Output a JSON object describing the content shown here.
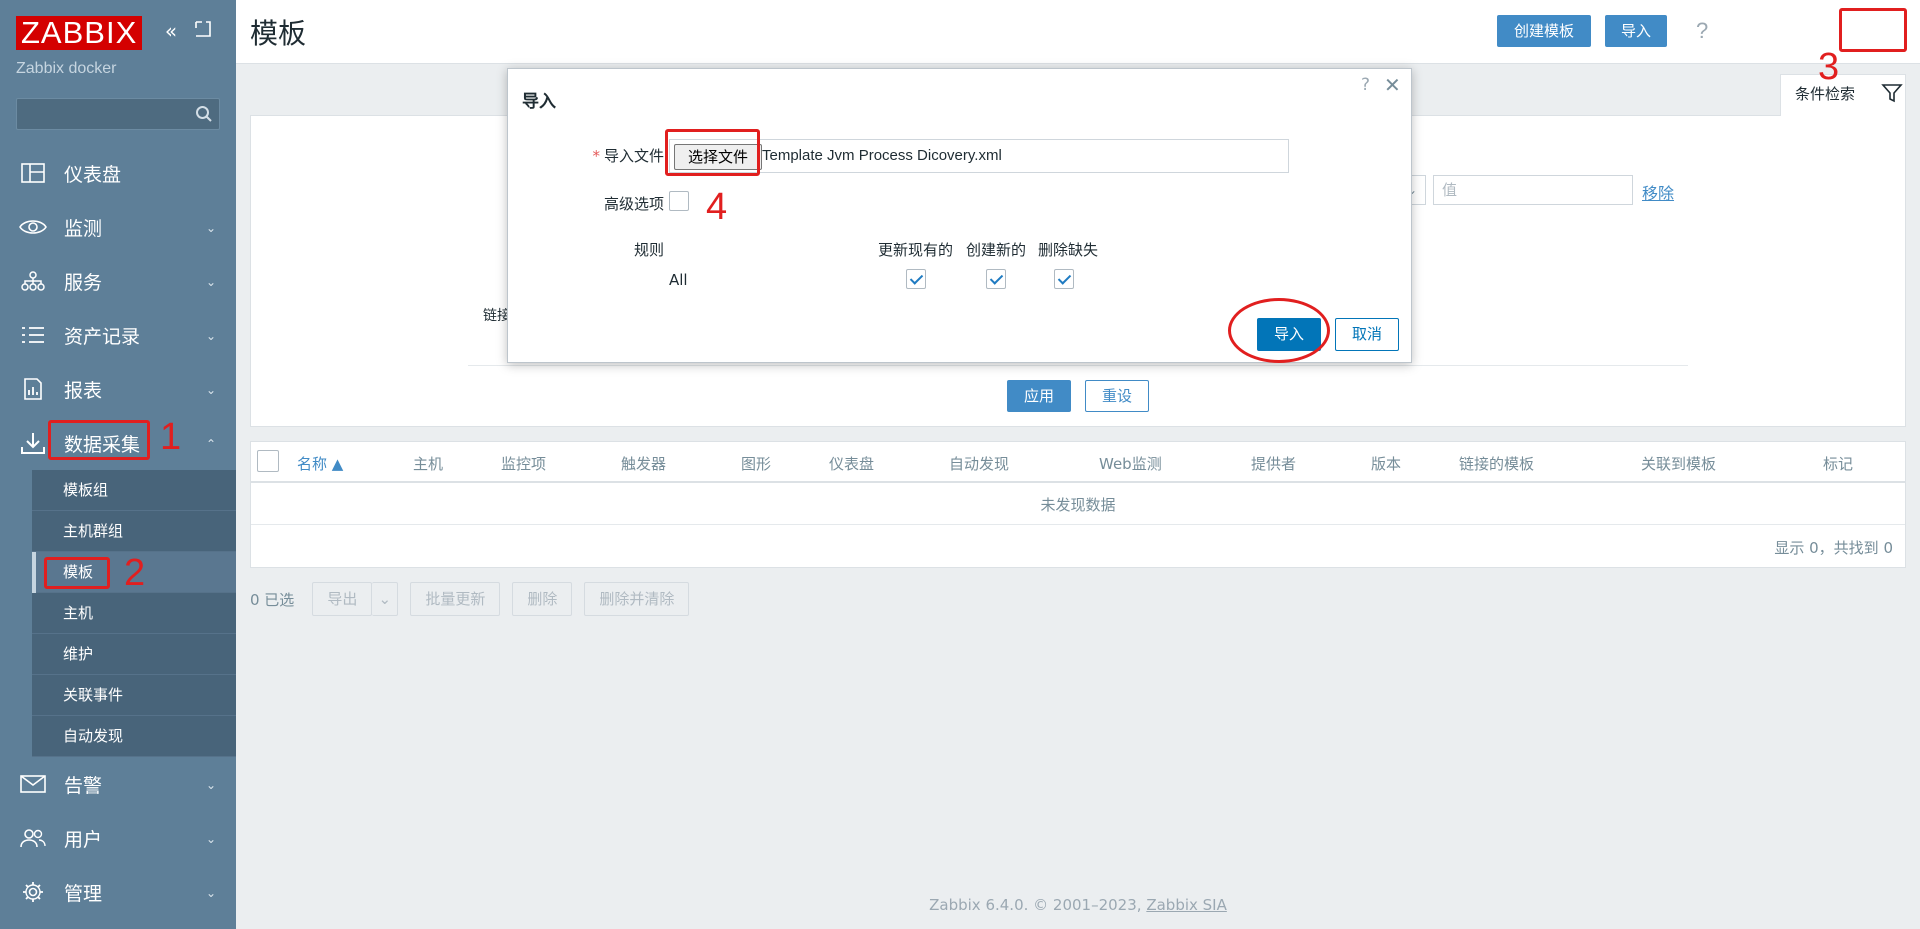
{
  "sidebar": {
    "logo": "ZABBIX",
    "site_name": "Zabbix docker",
    "search_placeholder": "",
    "menu": [
      {
        "label": "仪表盘",
        "icon": "dashboard-icon"
      },
      {
        "label": "监测",
        "icon": "eye-icon"
      },
      {
        "label": "服务",
        "icon": "services-icon"
      },
      {
        "label": "资产记录",
        "icon": "list-icon"
      },
      {
        "label": "报表",
        "icon": "report-icon"
      },
      {
        "label": "数据采集",
        "icon": "download-icon"
      },
      {
        "label": "告警",
        "icon": "envelope-icon"
      },
      {
        "label": "用户",
        "icon": "users-icon"
      },
      {
        "label": "管理",
        "icon": "gear-icon"
      }
    ],
    "submenu": [
      "模板组",
      "主机群组",
      "模板",
      "主机",
      "维护",
      "关联事件",
      "自动发现"
    ]
  },
  "annotations": {
    "n1": "1",
    "n2": "2",
    "n3": "3",
    "n4": "4"
  },
  "header": {
    "title": "模板",
    "help": "?",
    "create_button": "创建模板",
    "import_button": "导入"
  },
  "filter": {
    "tab_label": "条件检索",
    "link_label_partial": "链接",
    "value_placeholder": "值",
    "remove_link": "移除",
    "apply_button": "应用",
    "reset_button": "重设"
  },
  "table": {
    "columns": [
      "名称 ▲",
      "主机",
      "监控项",
      "触发器",
      "图形",
      "仪表盘",
      "自动发现",
      "Web监测",
      "提供者",
      "版本",
      "链接的模板",
      "关联到模板",
      "标记"
    ],
    "empty_text": "未发现数据",
    "paging": "显示 0，共找到 0"
  },
  "bulk": {
    "selected": "0 已选",
    "export": "导出",
    "mass_update": "批量更新",
    "delete": "删除",
    "delete_clear": "删除并清除"
  },
  "modal": {
    "title": "导入",
    "help": "?",
    "close": "✕",
    "file_label": "导入文件",
    "file_button": "选择文件",
    "file_name": "Template Jvm Process Dicovery.xml",
    "advanced_label": "高级选项",
    "rules_label": "规则",
    "col_update": "更新现有的",
    "col_create": "创建新的",
    "col_delete": "删除缺失",
    "row_all": "All",
    "import_button": "导入",
    "cancel_button": "取消"
  },
  "footer": {
    "text": "Zabbix 6.4.0. © 2001–2023,",
    "link": "Zabbix SIA"
  }
}
